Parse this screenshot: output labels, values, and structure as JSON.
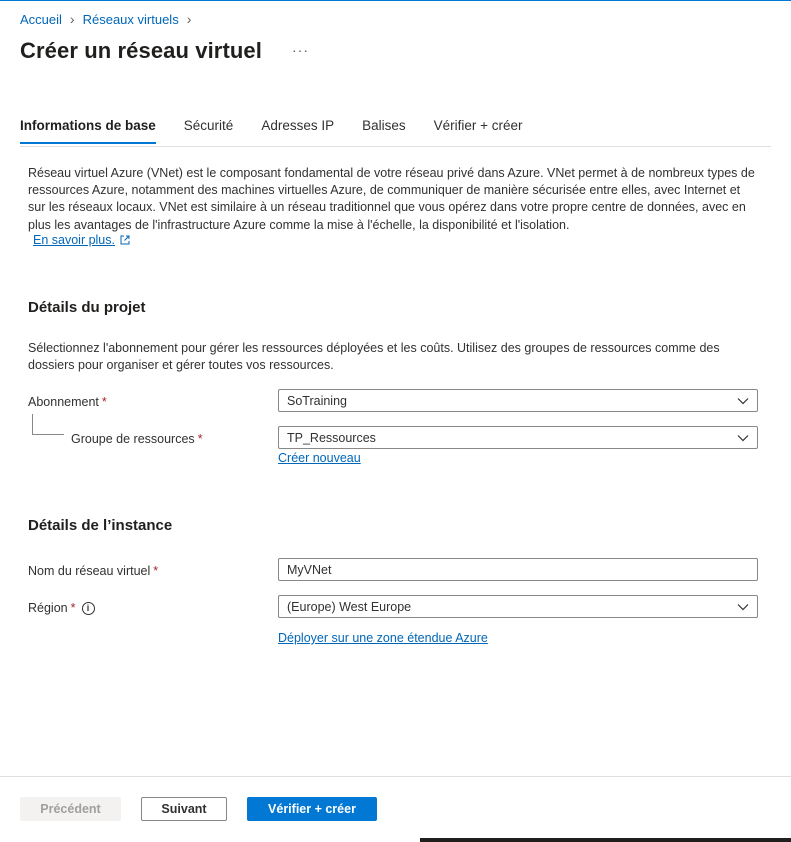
{
  "breadcrumb": {
    "items": [
      {
        "label": "Accueil"
      },
      {
        "label": "Réseaux virtuels"
      }
    ]
  },
  "page": {
    "title": "Créer un réseau virtuel",
    "more": "···"
  },
  "tabs": [
    {
      "label": "Informations de base",
      "active": true
    },
    {
      "label": "Sécurité",
      "active": false
    },
    {
      "label": "Adresses IP",
      "active": false
    },
    {
      "label": "Balises",
      "active": false
    },
    {
      "label": "Vérifier + créer",
      "active": false
    }
  ],
  "intro": {
    "text": "Réseau virtuel Azure (VNet) est le composant fondamental de votre réseau privé dans Azure. VNet permet à de nombreux types de ressources Azure, notamment des machines virtuelles Azure, de communiquer de manière sécurisée entre elles, avec Internet et sur les réseaux locaux. VNet est similaire à un réseau traditionnel que vous opérez dans votre propre centre de données, avec en plus les avantages de l'infrastructure Azure comme la mise à l'échelle, la disponibilité et l'isolation.",
    "learn_more": "En savoir plus."
  },
  "project": {
    "title": "Détails du projet",
    "description": "Sélectionnez l'abonnement pour gérer les ressources déployées et les coûts. Utilisez des groupes de ressources comme des dossiers pour organiser et gérer toutes vos ressources.",
    "subscription_label": "Abonnement",
    "subscription_value": "SoTraining",
    "resource_group_label": "Groupe de ressources",
    "resource_group_value": "TP_Ressources",
    "create_new": "Créer nouveau"
  },
  "instance": {
    "title": "Détails de l’instance",
    "vnet_name_label": "Nom du réseau virtuel",
    "vnet_name_value": "MyVNet",
    "region_label": "Région",
    "region_value": "(Europe) West Europe",
    "deploy_link": "Déployer sur une zone étendue Azure"
  },
  "required_mark": "*",
  "footer": {
    "previous": "Précédent",
    "next": "Suivant",
    "review_create": "Vérifier + créer"
  },
  "colors": {
    "accent": "#0078d4",
    "link": "#0066b8",
    "required": "#a4262c"
  }
}
